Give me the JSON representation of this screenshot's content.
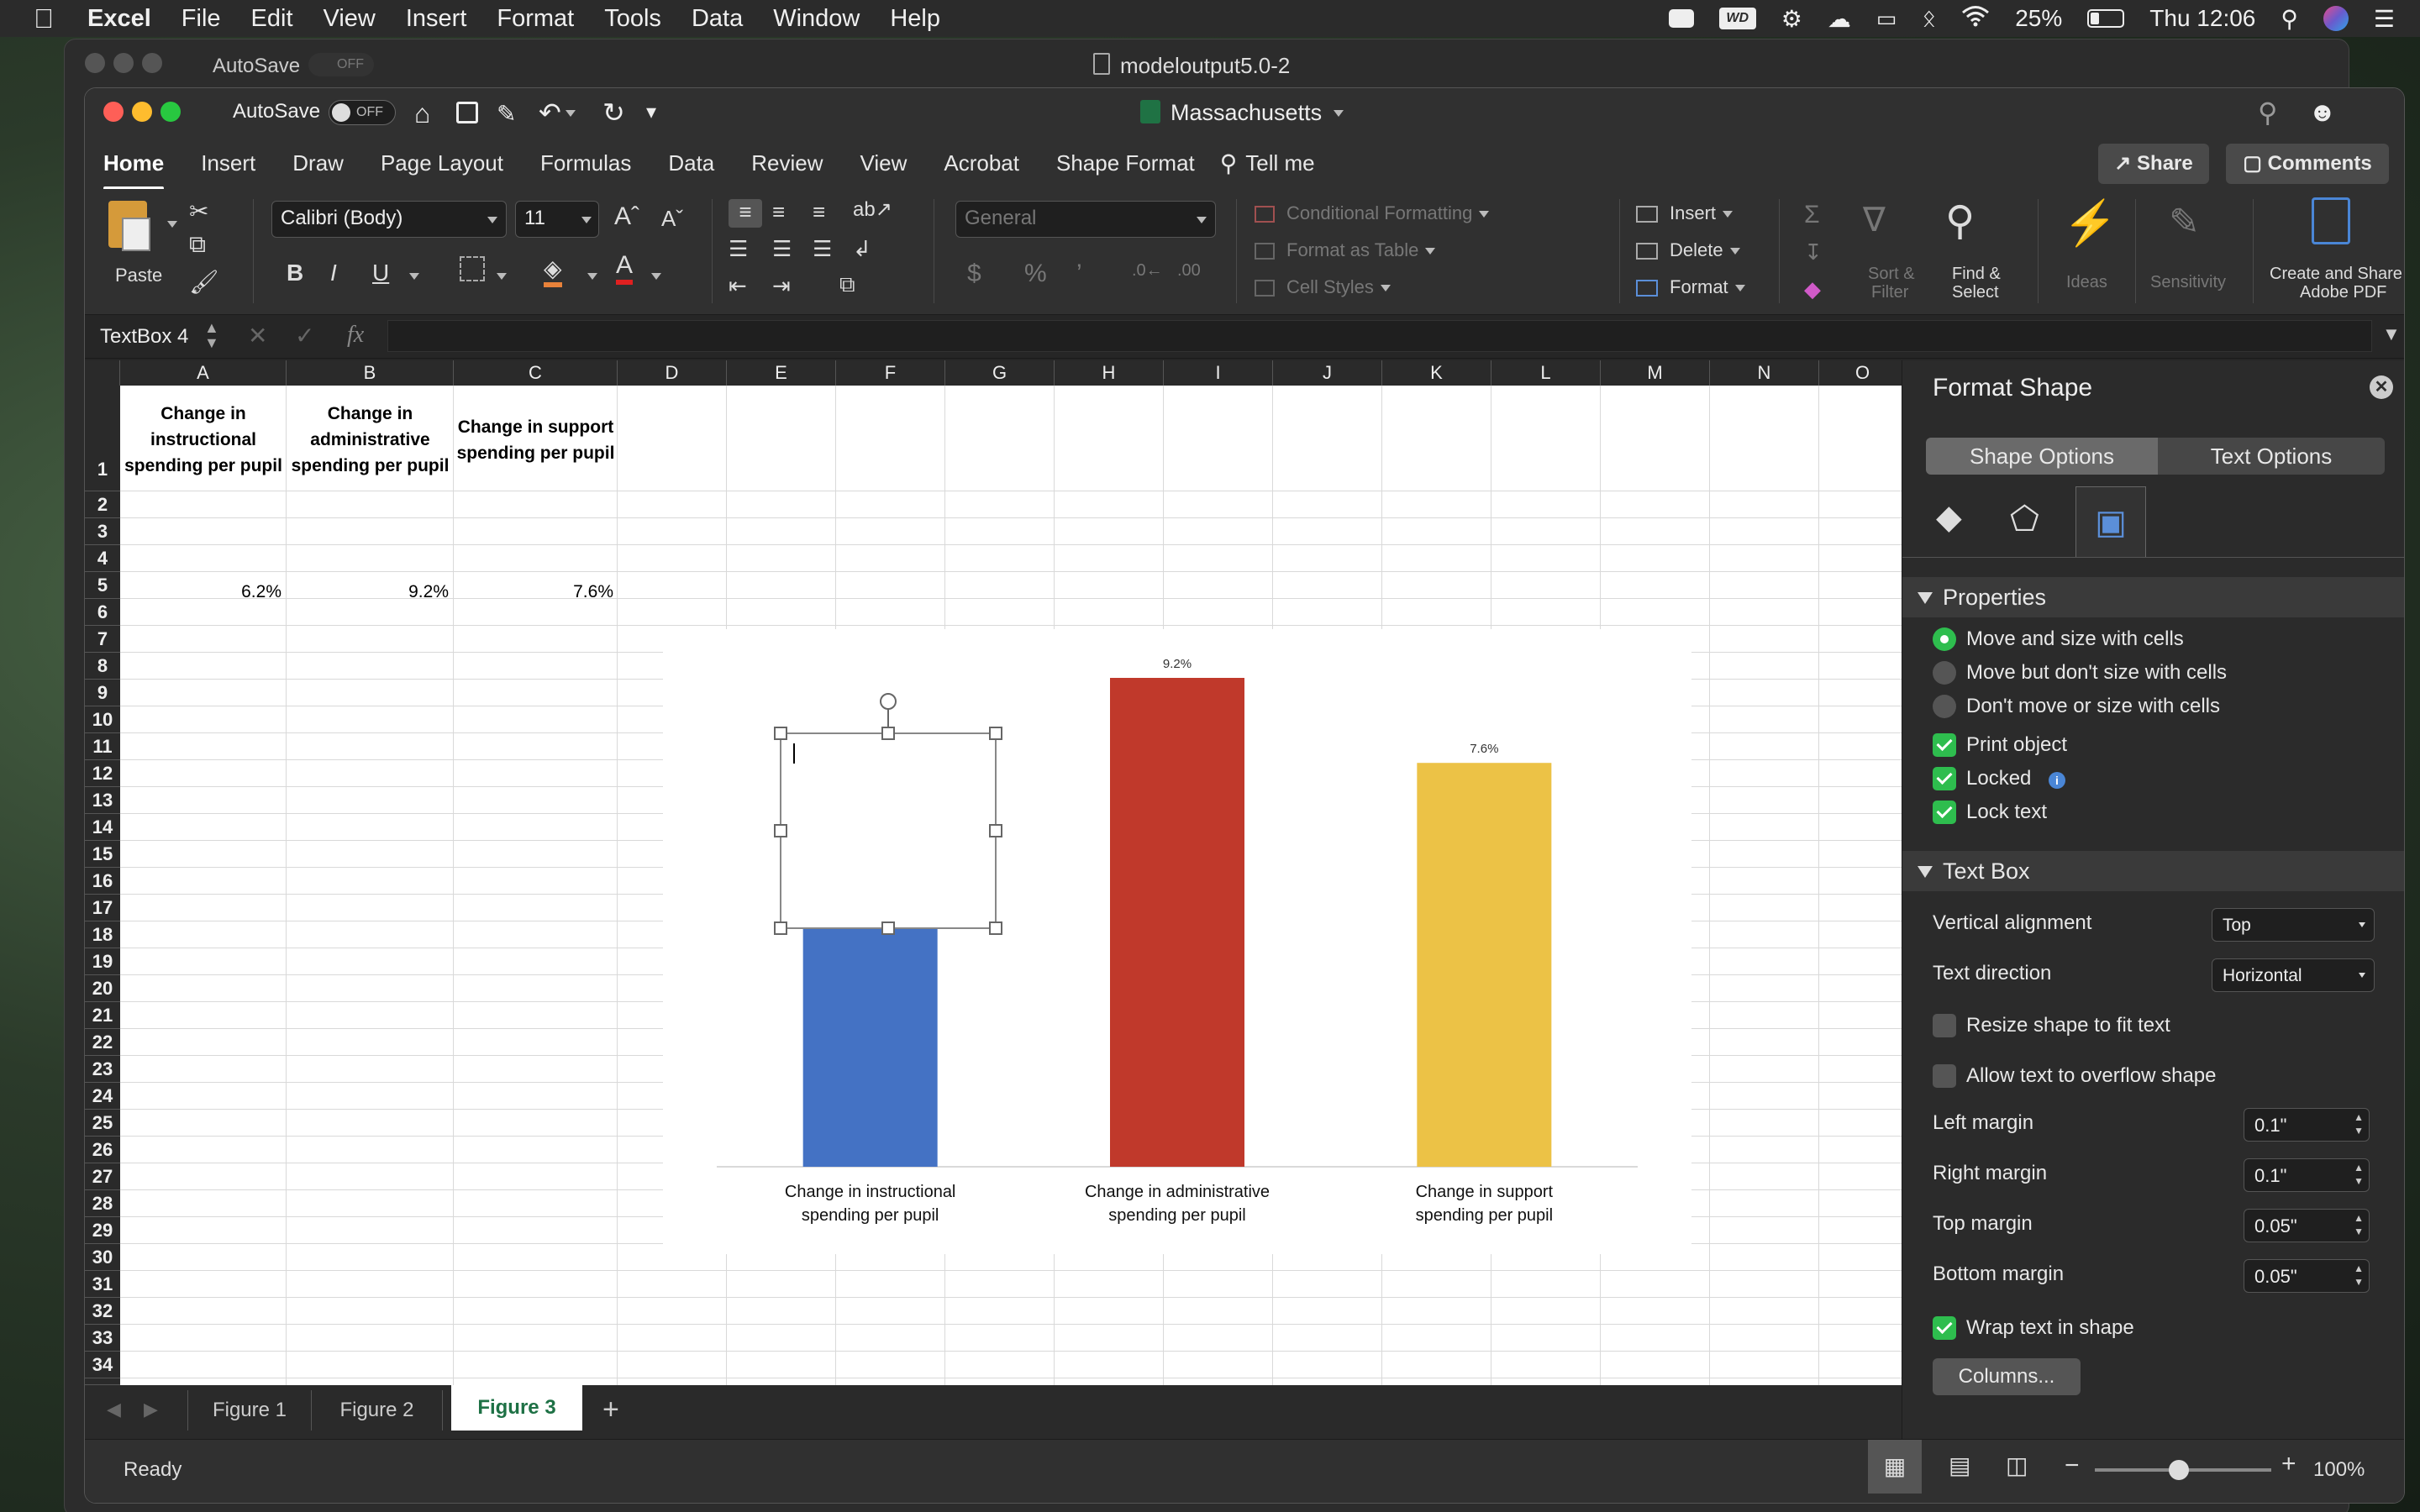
{
  "menubar": {
    "app": "Excel",
    "items": [
      "File",
      "Edit",
      "View",
      "Insert",
      "Format",
      "Tools",
      "Data",
      "Window",
      "Help"
    ],
    "battery": "25%",
    "clock": "Thu 12:06"
  },
  "back_window": {
    "autosave": "AutoSave",
    "toggle": "OFF",
    "title": "modeloutput5.0-2"
  },
  "window": {
    "autosave": "AutoSave",
    "toggle": "OFF",
    "title": "Massachusetts"
  },
  "ribbon_tabs": [
    "Home",
    "Insert",
    "Draw",
    "Page Layout",
    "Formulas",
    "Data",
    "Review",
    "View",
    "Acrobat",
    "Shape Format",
    "Tell me"
  ],
  "ribbon_actions": {
    "share": "Share",
    "comments": "Comments"
  },
  "ribbon": {
    "paste": "Paste",
    "font_name": "Calibri (Body)",
    "font_size": "11",
    "bold": "B",
    "italic": "I",
    "underline": "U",
    "number_format": "General",
    "conditional_formatting": "Conditional Formatting",
    "format_as_table": "Format as Table",
    "cell_styles": "Cell Styles",
    "insert": "Insert",
    "delete": "Delete",
    "format": "Format",
    "sort_filter_1": "Sort &",
    "sort_filter_2": "Filter",
    "find_select_1": "Find &",
    "find_select_2": "Select",
    "ideas": "Ideas",
    "sensitivity": "Sensitivity",
    "adobe_1": "Create and Share",
    "adobe_2": "Adobe PDF"
  },
  "formula_bar": {
    "name_box": "TextBox 4",
    "fx": "fx",
    "formula": ""
  },
  "columns": [
    "A",
    "B",
    "C",
    "D",
    "E",
    "F",
    "G",
    "H",
    "I",
    "J",
    "K",
    "L",
    "M",
    "N",
    "O"
  ],
  "rows": [
    "1",
    "2",
    "3",
    "4",
    "5",
    "6",
    "7",
    "8",
    "9",
    "10",
    "11",
    "12",
    "13",
    "14",
    "15",
    "16",
    "17",
    "18",
    "19",
    "20",
    "21",
    "22",
    "23",
    "24",
    "25",
    "26",
    "27",
    "28",
    "29",
    "30",
    "31",
    "32",
    "33",
    "34"
  ],
  "cells": {
    "A1": [
      "Change in",
      "instructional",
      "spending per pupil"
    ],
    "B1": [
      "Change in",
      "administrative",
      "spending per pupil"
    ],
    "C1": [
      "Change in support",
      "spending per pupil"
    ],
    "A2": "6.2%",
    "B2": "9.2%",
    "C2": "7.6%"
  },
  "chart_data": {
    "type": "bar",
    "categories": [
      "Change in instructional spending per pupil",
      "Change in administrative spending per pupil",
      "Change in support spending per pupil"
    ],
    "category_lines": [
      [
        "Change in instructional",
        "spending per pupil"
      ],
      [
        "Change in administrative",
        "spending per pupil"
      ],
      [
        "Change in support",
        "spending per pupil"
      ]
    ],
    "values": [
      6.2,
      9.2,
      7.6
    ],
    "data_labels": [
      "",
      "9.2%",
      "7.6%"
    ],
    "colors": [
      "#4472c4",
      "#c0392b",
      "#ecc246"
    ],
    "ylim": [
      0,
      9.2
    ],
    "title": "",
    "xlabel": "",
    "ylabel": ""
  },
  "sheet_tabs": [
    "Figure 1",
    "Figure 2",
    "Figure 3"
  ],
  "active_sheet": "Figure 3",
  "status": {
    "ready": "Ready",
    "zoom": "100%"
  },
  "panel": {
    "title": "Format Shape",
    "tab_shape": "Shape Options",
    "tab_text": "Text Options",
    "properties": "Properties",
    "opt_move_size": "Move and size with cells",
    "opt_move_only": "Move but don't size with cells",
    "opt_none": "Don't move or size with cells",
    "print_object": "Print object",
    "locked": "Locked",
    "lock_text": "Lock text",
    "text_box": "Text Box",
    "vertical_alignment": "Vertical alignment",
    "vertical_alignment_value": "Top",
    "text_direction": "Text direction",
    "text_direction_value": "Horizontal",
    "resize_shape": "Resize shape to fit text",
    "allow_overflow": "Allow text to overflow shape",
    "left_margin": "Left margin",
    "left_margin_value": "0.1\"",
    "right_margin": "Right margin",
    "right_margin_value": "0.1\"",
    "top_margin": "Top margin",
    "top_margin_value": "0.05\"",
    "bottom_margin": "Bottom margin",
    "bottom_margin_value": "0.05\"",
    "wrap_text": "Wrap text in shape",
    "columns_button": "Columns..."
  }
}
